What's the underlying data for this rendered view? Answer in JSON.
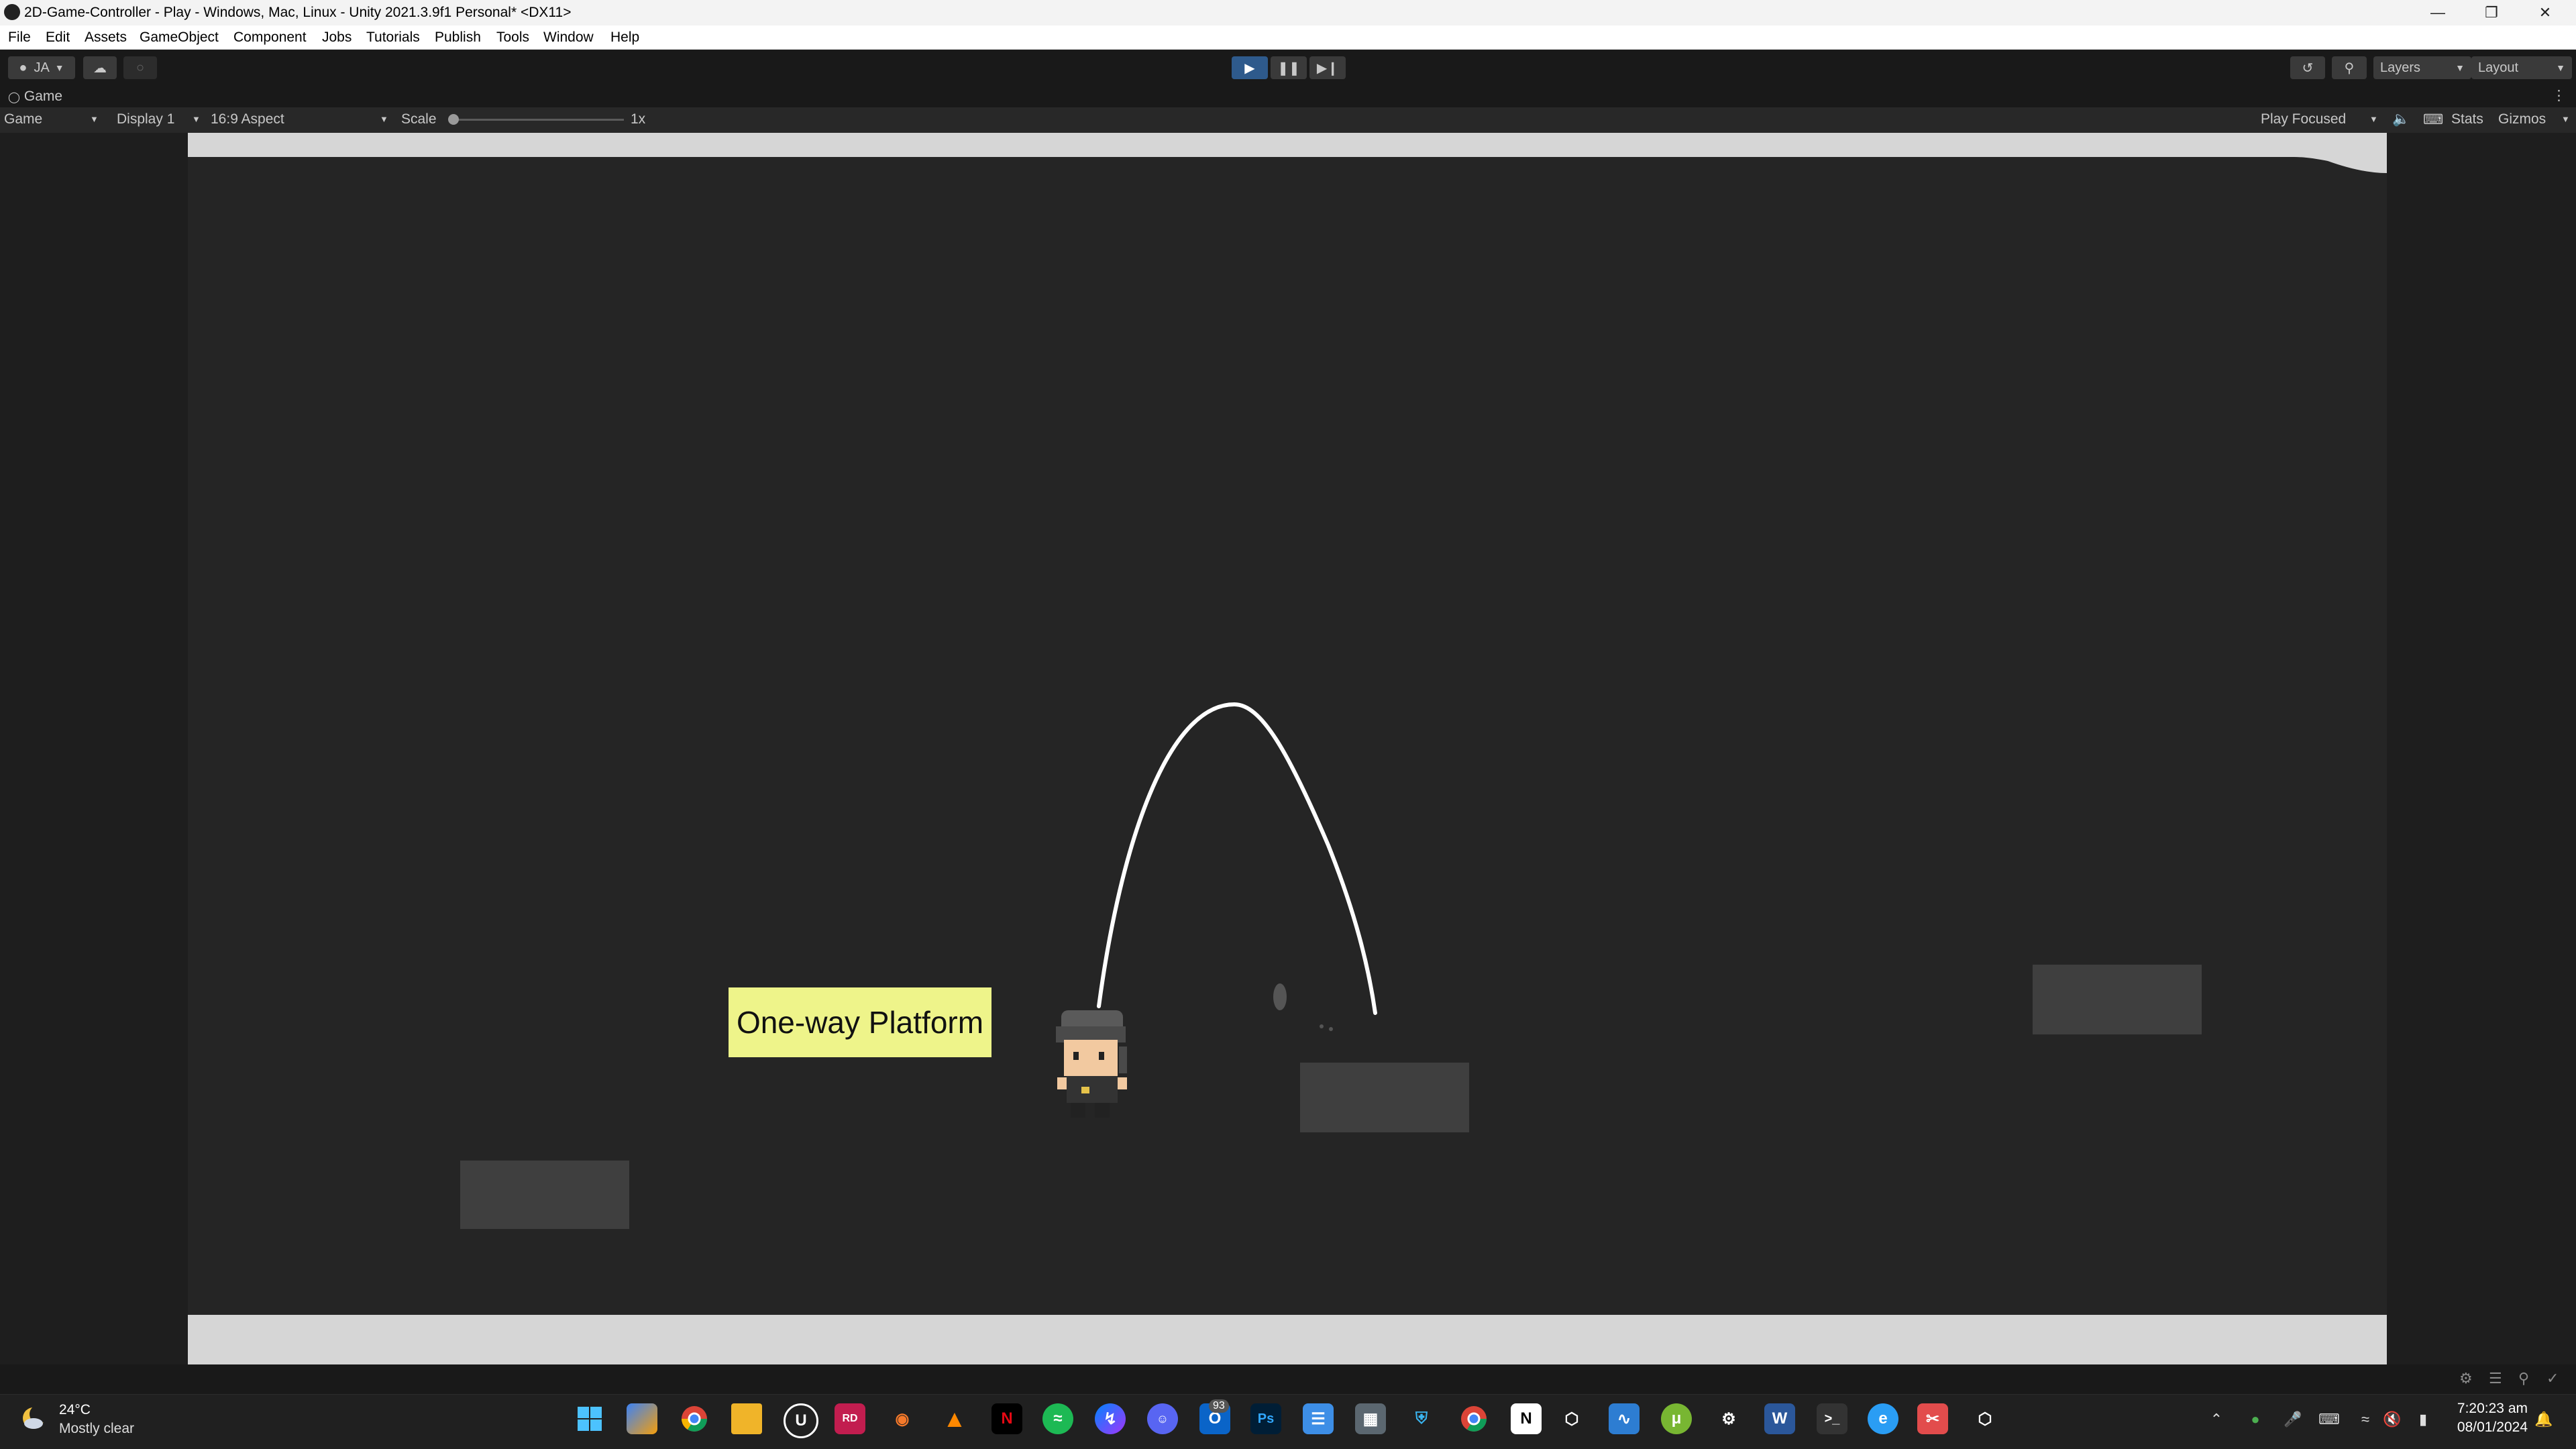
{
  "window": {
    "title": "2D-Game-Controller - Play - Windows, Mac, Linux - Unity 2021.3.9f1 Personal* <DX11>"
  },
  "menu": [
    "File",
    "Edit",
    "Assets",
    "GameObject",
    "Component",
    "Jobs",
    "Tutorials",
    "Publish",
    "Tools",
    "Window",
    "Help"
  ],
  "toolbar": {
    "account": "JA",
    "layers": "Layers",
    "layout": "Layout"
  },
  "game_tab": {
    "label": "Game",
    "view_select": "Game",
    "display_select": "Display 1",
    "aspect_select": "16:9 Aspect",
    "scale_label": "Scale",
    "scale_value": "1x",
    "play_mode": "Play Focused",
    "stats": "Stats",
    "gizmos": "Gizmos"
  },
  "scene": {
    "sign_text": "One-way Platform"
  },
  "taskbar": {
    "weather_temp": "24°C",
    "weather_desc": "Mostly clear",
    "time": "7:20:23 am",
    "date": "08/01/2024",
    "badge_count": "93",
    "icons": [
      "start-icon",
      "copilot-icon",
      "chrome-icon",
      "file-explorer-icon",
      "unreal-icon",
      "rider-icon",
      "blender-icon",
      "vlc-icon",
      "netflix-icon",
      "spotify-icon",
      "messenger-icon",
      "discord-icon",
      "outlook-icon",
      "photoshop-icon",
      "notepad-icon",
      "calculator-icon",
      "malwarebytes-icon",
      "chrome-alt-icon",
      "notion-icon",
      "unity-hub-icon",
      "task-manager-icon",
      "utorrent-icon",
      "settings-icon",
      "word-icon",
      "terminal-icon",
      "edge-icon",
      "snip-icon",
      "unity-icon"
    ]
  },
  "colors": {
    "sign_bg": "#eef48a",
    "platform": "#3f3f3f",
    "game_bg": "#252525",
    "play_active": "#2e5a8c"
  }
}
